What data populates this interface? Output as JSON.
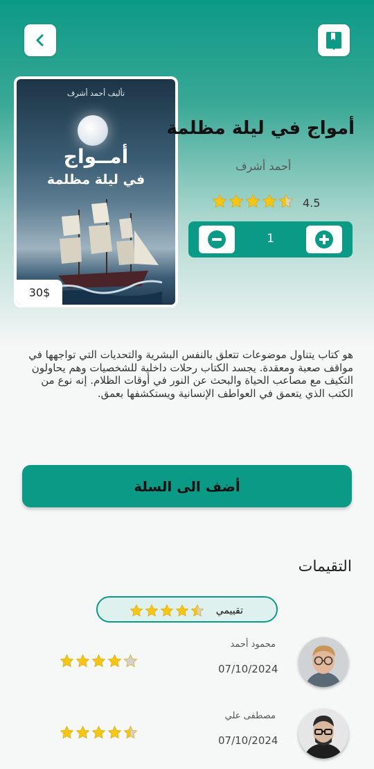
{
  "header": {
    "back_icon": "chevron-left-icon",
    "bookmark_icon": "book-bookmark-icon"
  },
  "book": {
    "title": "أمواج في ليلة مظلمة",
    "author": "أحمد أشرف",
    "rating": "4.5",
    "rating_value": 4.5,
    "price": "30$",
    "cover": {
      "author_line": "تأليف أحمد أشرف",
      "title_line1": "أمــواج",
      "title_line2": "في ليلة مظلمة"
    },
    "description": "هو كتاب يتناول موضوعات تتعلق بالنفس البشرية والتحديات التي تواجهها في مواقف صعبة ومعقدة. يجسد الكتاب رحلات داخلية للشخصيات وهم يحاولون التكيف مع مصاعب الحياة والبحث عن النور في أوقات الظلام. إنه نوع من الكتب الذي يتعمق في العواطف الإنسانية ويستكشفها بعمق."
  },
  "quantity": {
    "value": "1",
    "minus_icon": "minus-circle-icon",
    "plus_icon": "plus-circle-icon"
  },
  "add_to_cart_label": "أضف الى السلة",
  "reviews": {
    "title": "التقيمات",
    "my_rating_label": "تقييمي",
    "my_rating_value": 4.5,
    "items": [
      {
        "name": "محمود أحمد",
        "date": "07/10/2024",
        "stars": 4
      },
      {
        "name": "مصطفى علي",
        "date": "07/10/2024",
        "stars": 4.5
      }
    ]
  },
  "colors": {
    "primary": "#0b9a86",
    "star": "#f5c518",
    "star_empty": "#d3d3d3"
  }
}
